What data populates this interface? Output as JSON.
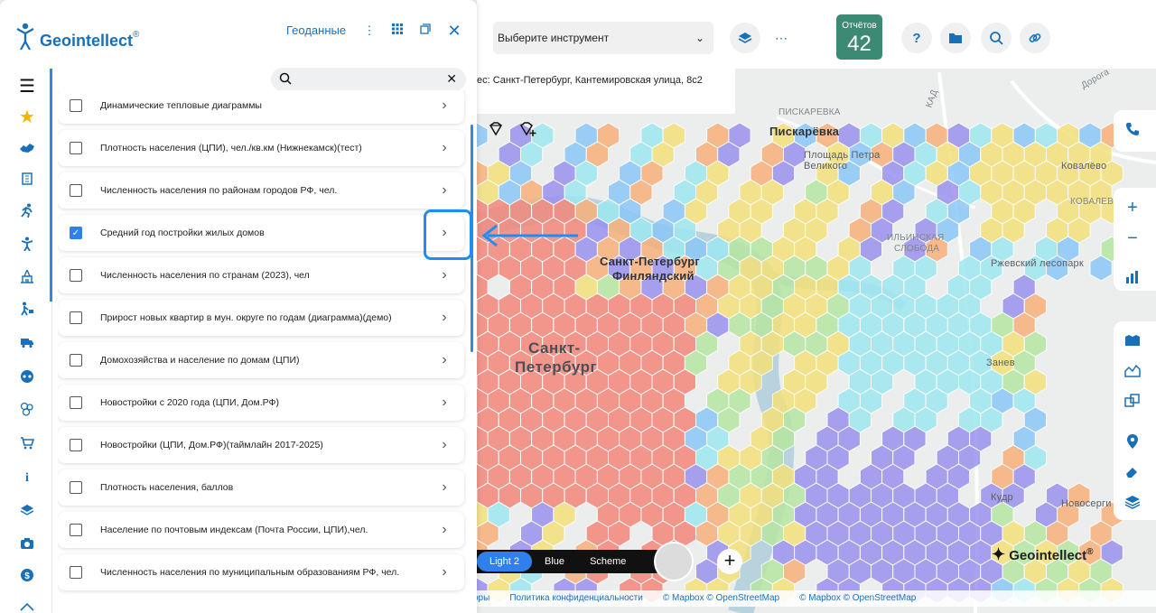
{
  "panel": {
    "brand": "Geointellect",
    "brand_mark": "®",
    "geo_link": "Геоданные",
    "search": {
      "value": "",
      "placeholder": ""
    },
    "layers": [
      {
        "label": "Динамические тепловые диаграммы",
        "checked": false
      },
      {
        "label": "Плотность населения (ЦПИ), чел./кв.км (Нижнекамск)(тест)",
        "checked": false
      },
      {
        "label": "Численность населения по районам городов РФ, чел.",
        "checked": false
      },
      {
        "label": "Средний год постройки жилых домов",
        "checked": true
      },
      {
        "label": "Численность населения по странам (2023), чел",
        "checked": false
      },
      {
        "label": "Прирост новых квартир в мун. округе по годам (диаграмма)(демо)",
        "checked": false
      },
      {
        "label": "Домохозяйства и население по домам (ЦПИ)",
        "checked": false
      },
      {
        "label": "Новостройки с 2020 года (ЦПИ, Дом.РФ)",
        "checked": false
      },
      {
        "label": "Новостройки (ЦПИ, Дом.РФ)(таймлайн 2017-2025)",
        "checked": false
      },
      {
        "label": "Плотность населения, баллов",
        "checked": false
      },
      {
        "label": "Население по почтовым индексам (Почта России, ЦПИ),чел.",
        "checked": false
      },
      {
        "label": "Численность населения по муниципальным образованиям РФ, чел.",
        "checked": false
      }
    ]
  },
  "topbar": {
    "tool_select": "Выберите инструмент",
    "reports_label": "Отчётов",
    "reports_count": "42",
    "address": "ес: Санкт-Петербург, Кантемировская улица, 8с2"
  },
  "map": {
    "labels": {
      "piskarevka": "ПИСКАРЕВКА",
      "piskarevka2": "Пискарёвка",
      "peter": "Площадь Петра",
      "velikogo": "Великого",
      "spb_fin": "Санкт-Петербург",
      "fin": "Финляндский",
      "spb": "Санкт-",
      "spb2": "Петербург",
      "ilinsky": "ИЛЬИНСКАЯ",
      "sloboda": "СЛОБОДА",
      "rzhevsky": "Ржевский лесопарк",
      "kovalevo": "Ковалёво",
      "kovalevo2": "КОВАЛЕВО",
      "novoserg": "Новосерги",
      "zanevka": "Занев",
      "kudrovo": "Кудр",
      "kad": "КАД",
      "doroga": "Дорога"
    },
    "styles": [
      "Light 2",
      "Blue",
      "Scheme"
    ],
    "active_style": "Light 2",
    "brand": "Geointellect",
    "brand_mark": "®",
    "footer": [
      "оры",
      "Политика конфиденциальности",
      "© Mapbox © OpenStreetMap",
      "© Mapbox © OpenStreetMap"
    ]
  }
}
